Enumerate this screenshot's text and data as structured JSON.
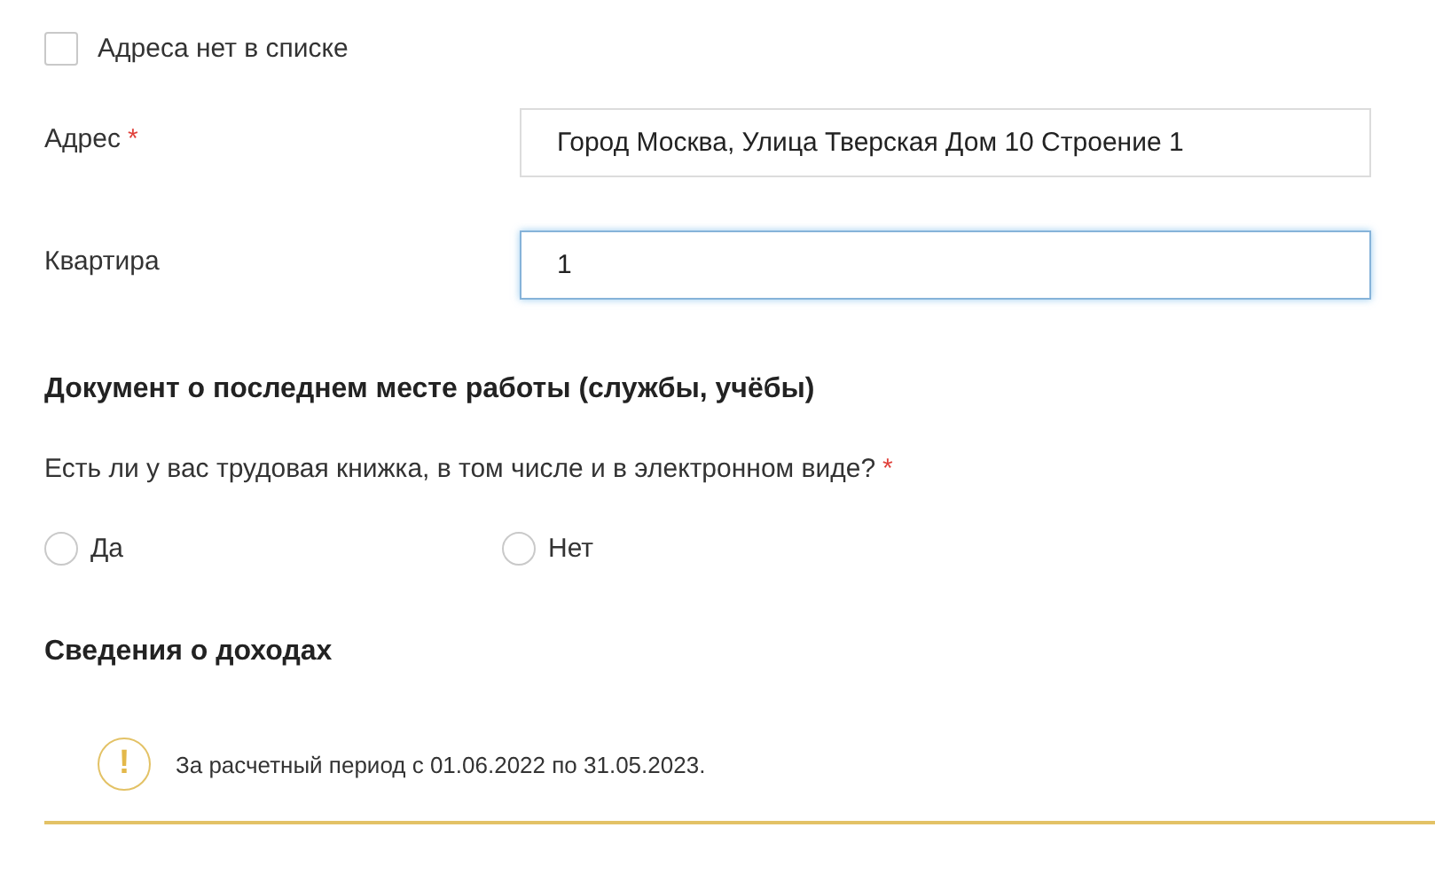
{
  "address_not_listed": {
    "label": "Адреса нет в списке",
    "checked": false
  },
  "fields": [
    {
      "label": "Адрес",
      "required_mark": "*",
      "value": "Город Москва, Улица Тверская Дом 10 Строение 1",
      "focused": false
    },
    {
      "label": "Квартира",
      "value": "1",
      "focused": true
    }
  ],
  "work_section": {
    "heading": "Документ о последнем месте работы (службы, учёбы)",
    "question": "Есть ли у вас трудовая книжка, в том числе и в электронном виде?",
    "required_mark": "*",
    "options": [
      {
        "label": "Да",
        "selected": false
      },
      {
        "label": "Нет",
        "selected": false
      }
    ]
  },
  "income_section": {
    "heading": "Сведения о доходах",
    "notice": {
      "icon": "!",
      "text": "За расчетный период с 01.06.2022 по 31.05.2023."
    }
  }
}
